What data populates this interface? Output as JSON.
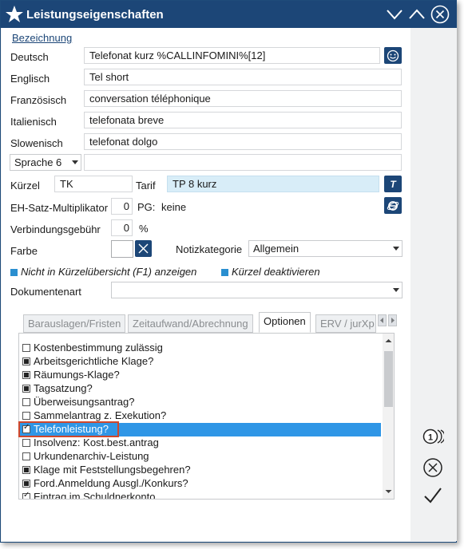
{
  "window": {
    "title": "Leistungseigenschaften"
  },
  "section": {
    "label": "Bezeichnung"
  },
  "names": [
    {
      "label": "Deutsch",
      "value": "Telefonat kurz %CALLINFOMINI%[12]"
    },
    {
      "label": "Englisch",
      "value": "Tel short"
    },
    {
      "label": "Französisch",
      "value": "conversation téléphonique"
    },
    {
      "label": "Italienisch",
      "value": "telefonata breve"
    },
    {
      "label": "Slowenisch",
      "value": "telefonat dolgo"
    }
  ],
  "language6": {
    "selected": "Sprache 6",
    "value": ""
  },
  "kuerzel": {
    "label": "Kürzel",
    "value": "TK"
  },
  "tarif": {
    "label": "Tarif",
    "value": "TP 8 kurz",
    "button": "T"
  },
  "eh": {
    "label": "EH-Satz-Multiplikator",
    "value": "0",
    "pg_label": "PG:",
    "pg_value": "keine"
  },
  "verbindung": {
    "label": "Verbindungsgebühr",
    "value": "0",
    "unit": "%"
  },
  "farbe": {
    "label": "Farbe"
  },
  "notiz": {
    "label": "Notizkategorie",
    "value": "Allgemein"
  },
  "flags": {
    "not_in_overview": "Nicht in Kürzelübersicht (F1) anzeigen",
    "deactivate": "Kürzel deaktivieren"
  },
  "dokumentenart": {
    "label": "Dokumentenart",
    "value": ""
  },
  "tabs": [
    "Barauslagen/Fristen",
    "Zeitaufwand/Abrechnung",
    "Optionen",
    "ERV / jurXp"
  ],
  "options": [
    {
      "label": "Kostenbestimmung zulässig",
      "state": "empty"
    },
    {
      "label": "Arbeitsgerichtliche Klage?",
      "state": "fill"
    },
    {
      "label": "Räumungs-Klage?",
      "state": "fill"
    },
    {
      "label": "Tagsatzung?",
      "state": "fill"
    },
    {
      "label": "Überweisungsantrag?",
      "state": "empty"
    },
    {
      "label": "Sammelantrag z. Exekution?",
      "state": "empty"
    },
    {
      "label": "Telefonleistung?",
      "state": "check"
    },
    {
      "label": "Insolvenz: Kost.best.antrag",
      "state": "empty"
    },
    {
      "label": "Urkundenarchiv-Leistung",
      "state": "empty"
    },
    {
      "label": "Klage mit Feststellungsbegehren?",
      "state": "fill"
    },
    {
      "label": "Ford.Anmeldung Ausgl./Konkurs?",
      "state": "fill"
    },
    {
      "label": "Eintrag im Schuldnerkonto",
      "state": "check"
    }
  ],
  "colors": {
    "titlebar": "#1c4677",
    "selection": "#2f96e6",
    "accent": "#2a8fd0",
    "highlight": "#d0472b"
  }
}
